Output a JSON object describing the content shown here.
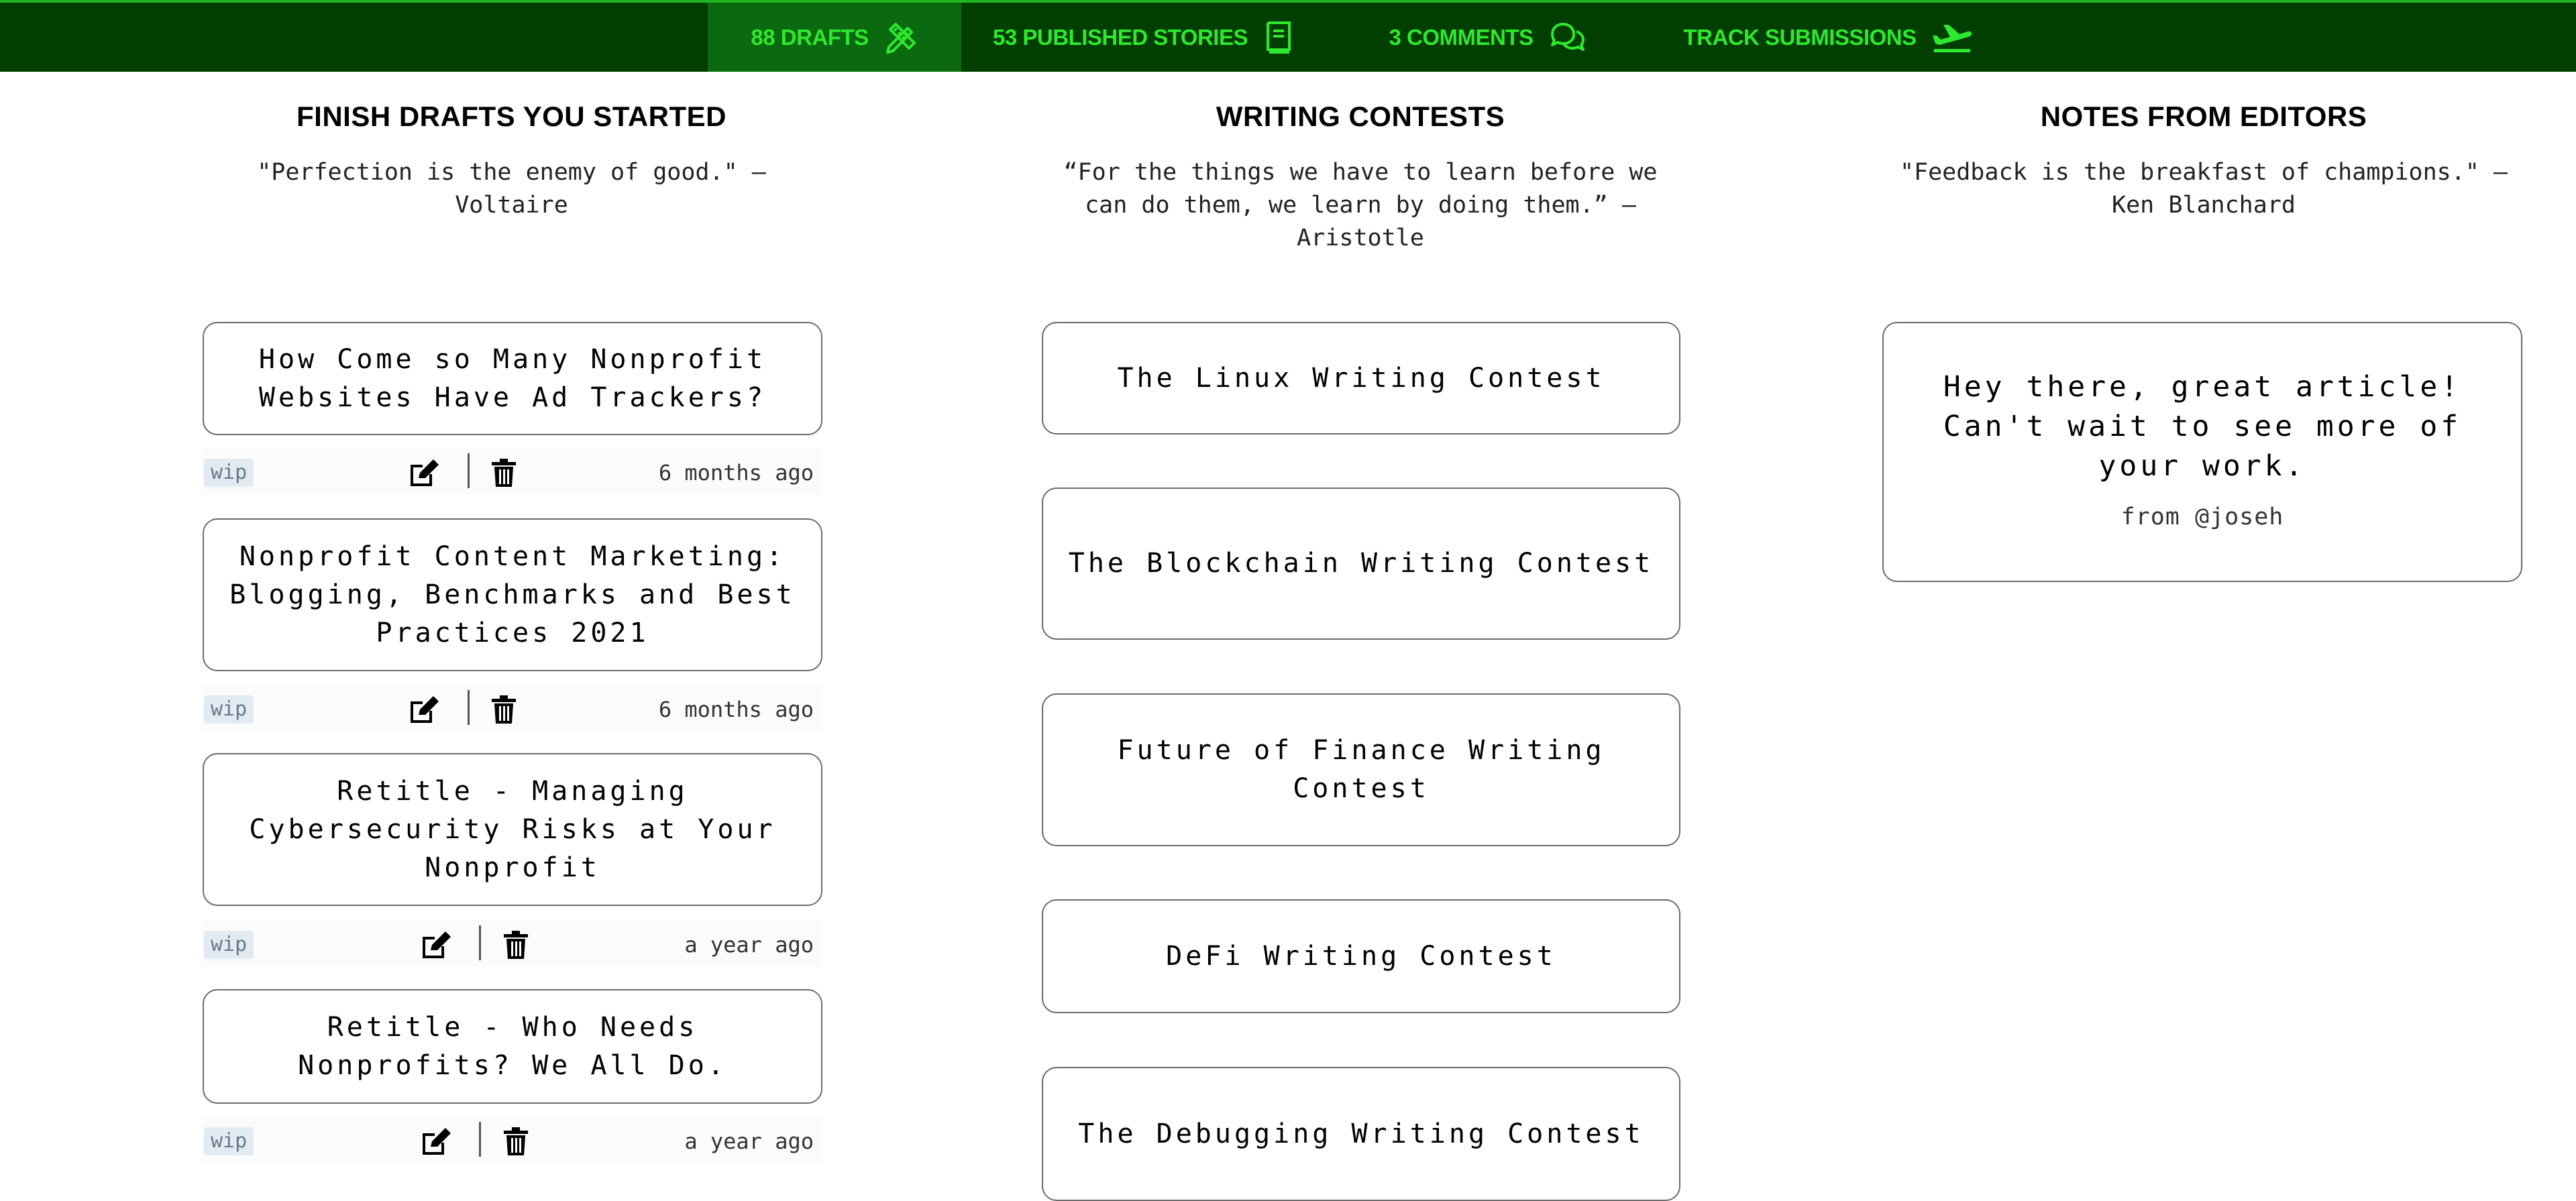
{
  "nav": {
    "drafts": "88 DRAFTS",
    "stories": "53 PUBLISHED STORIES",
    "comments": "3 COMMENTS",
    "submissions": "TRACK SUBMISSIONS"
  },
  "colors": {
    "nav_bg": "#003f00",
    "nav_active_bg": "#0b6a10",
    "nav_text": "#2ee82e",
    "tag_bg": "#e3ebf2"
  },
  "drafts": {
    "heading": "FINISH DRAFTS YOU STARTED",
    "quote": "\"Perfection is the enemy of good.\" — Voltaire",
    "items": [
      {
        "title": "How Come so Many Nonprofit Websites Have Ad Trackers?",
        "tag": "wip",
        "time": "6 months ago"
      },
      {
        "title": "Nonprofit Content Marketing: Blogging, Benchmarks and Best Practices 2021",
        "tag": "wip",
        "time": "6 months ago"
      },
      {
        "title": "Retitle - Managing Cybersecurity Risks at Your Nonprofit",
        "tag": "wip",
        "time": "a year ago"
      },
      {
        "title": "Retitle - Who Needs Nonprofits? We All Do.",
        "tag": "wip",
        "time": "a year ago"
      }
    ]
  },
  "contests": {
    "heading": "WRITING CONTESTS",
    "quote": "“For the things we have to learn before we can do them, we learn by doing them.” — Aristotle",
    "items": [
      "The Linux Writing Contest",
      "The Blockchain Writing Contest",
      "Future of Finance Writing Contest",
      "DeFi Writing Contest",
      "The Debugging Writing Contest"
    ]
  },
  "notes": {
    "heading": "NOTES FROM EDITORS",
    "quote": "\"Feedback is the breakfast of champions.\" — Ken Blanchard",
    "items": [
      {
        "text": "Hey there, great article! Can't wait to see more of your work.",
        "from": "from @joseh"
      }
    ]
  },
  "icons": {
    "drafts": "pencil-ruler-icon",
    "stories": "book-icon",
    "comments": "comments-icon",
    "submissions": "plane-departure-icon",
    "edit": "edit-icon",
    "delete": "trash-icon"
  }
}
